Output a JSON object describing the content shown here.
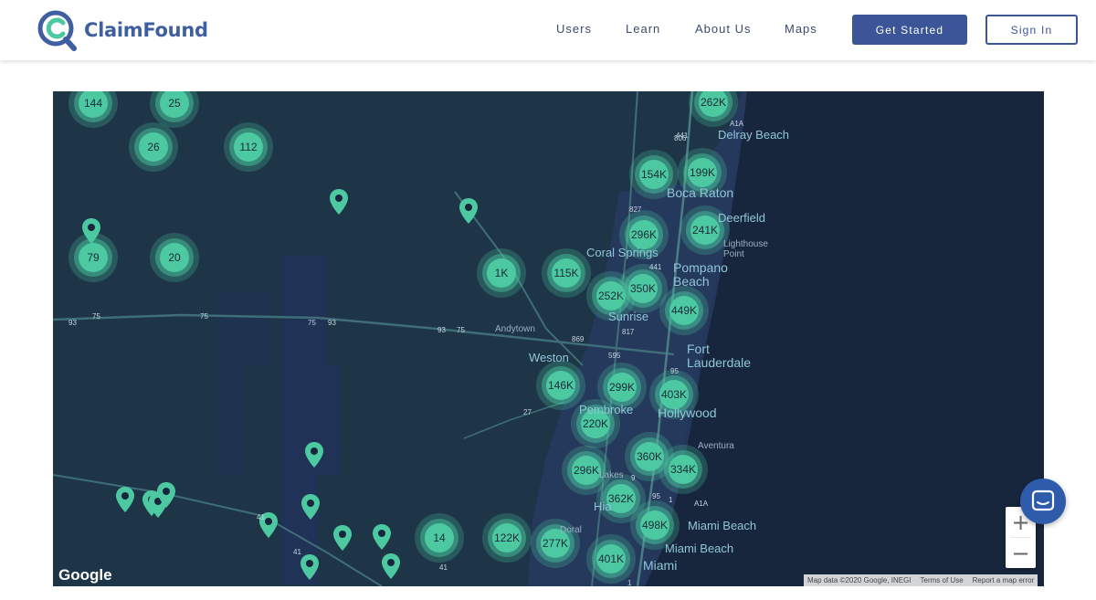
{
  "brand": {
    "name": "ClaimFound"
  },
  "nav": {
    "users": "Users",
    "learn": "Learn",
    "about": "About Us",
    "maps": "Maps",
    "get_started": "Get Started",
    "sign_in": "Sign In"
  },
  "map": {
    "clusters": [
      "144",
      "25",
      "26",
      "112",
      "79",
      "20",
      "1K",
      "115K",
      "262K",
      "154K",
      "199K",
      "296K",
      "241K",
      "252K",
      "350K",
      "449K",
      "146K",
      "299K",
      "403K",
      "220K",
      "360K",
      "334K",
      "296K",
      "362K",
      "498K",
      "14",
      "122K",
      "277K",
      "401K"
    ],
    "places": {
      "delray_beach": "Delray Beach",
      "boca_raton": "Boca Raton",
      "deerfield": "Deerfield",
      "coral_springs": "Coral Springs",
      "lighthouse_point": "Lighthouse\nPoint",
      "pompano_beach": "Pompano\nBeach",
      "sunrise": "Sunrise",
      "fort_lauderdale": "Fort\nLauderdale",
      "andytown": "Andytown",
      "weston": "Weston",
      "pembroke": "Pembroke",
      "hollywood": "Hollywood",
      "aventura": "Aventura",
      "miami_beach": "Miami Beach",
      "miami_beach_2": "Miami Beach",
      "miami": "Miami",
      "doral": "Doral",
      "lakes": "Lakes",
      "hialeah": "Hia"
    },
    "shields": [
      "441",
      "806",
      "A1A",
      "827",
      "441",
      "75",
      "75",
      "75",
      "93",
      "93",
      "93",
      "869",
      "817",
      "595",
      "95",
      "27",
      "95",
      "1",
      "A1A",
      "9",
      "41",
      "41",
      "41",
      "1",
      "75"
    ],
    "google": "Google",
    "attribution": {
      "data": "Map data ©2020 Google, INEGI",
      "terms": "Terms of Use",
      "report": "Report a map error"
    },
    "zoom_in": "+",
    "zoom_out": "−"
  },
  "colors": {
    "brand": "#3f5fa0",
    "cluster": "#4cc9a0",
    "map_bg": "#17263c",
    "land": "#1d3547",
    "urban": "#273a60",
    "water": "#17263c"
  },
  "icons": {
    "logo": "magnifier-c-logo-icon",
    "pin": "map-pin-icon",
    "chat": "chat-bubble-icon"
  }
}
